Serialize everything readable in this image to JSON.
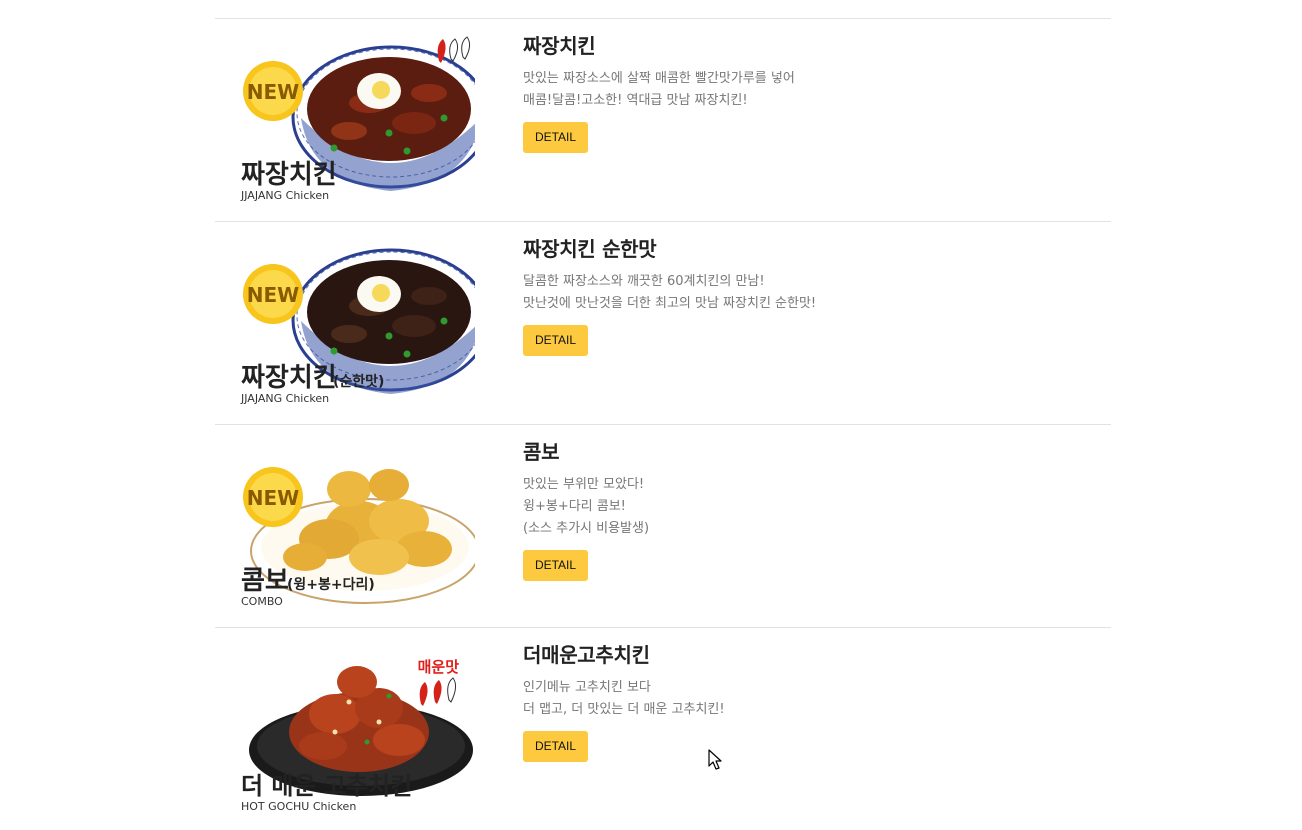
{
  "menu": [
    {
      "title": "짜장치킨",
      "desc": [
        "맛있는 짜장소스에 살짝 매콤한 빨간맛가루를 넣어",
        "매콤!달콤!고소한! 역대급 맛남 짜장치킨!"
      ],
      "button": "DETAIL",
      "img": {
        "badge": "NEW",
        "name": "짜장치킨",
        "sub": "",
        "eng": "JJAJANG Chicken",
        "tag": ""
      }
    },
    {
      "title": "짜장치킨 순한맛",
      "desc": [
        "달콤한 짜장소스와 깨끗한 60계치킨의 만남!",
        "맛난것에 맛난것을 더한 최고의 맛남 짜장치킨 순한맛!"
      ],
      "button": "DETAIL",
      "img": {
        "badge": "NEW",
        "name": "짜장치킨",
        "sub": "(순한맛)",
        "eng": "JJAJANG Chicken",
        "tag": ""
      }
    },
    {
      "title": "콤보",
      "desc": [
        "맛있는 부위만 모았다!",
        "윙+봉+다리 콤보!",
        "(소스 추가시 비용발생)"
      ],
      "button": "DETAIL",
      "img": {
        "badge": "NEW",
        "name": "콤보",
        "sub": "(윙+봉+다리)",
        "eng": "COMBO",
        "tag": ""
      }
    },
    {
      "title": "더매운고추치킨",
      "desc": [
        "인기메뉴 고추치킨 보다",
        "더 맵고, 더 맛있는 더 매운 고추치킨!"
      ],
      "button": "DETAIL",
      "img": {
        "badge": "",
        "name": "더 매운 고추치킨",
        "sub": "",
        "eng": "HOT GOCHU Chicken",
        "tag": "매운맛"
      }
    }
  ],
  "colors": {
    "button": "#fdc93e",
    "divider": "#e2e2e2",
    "badge": "#f7c51b",
    "spicy": "#e0201b"
  },
  "icons": {
    "cursor": "arrow-cursor-icon",
    "pepper": "chili-pepper-icon"
  }
}
